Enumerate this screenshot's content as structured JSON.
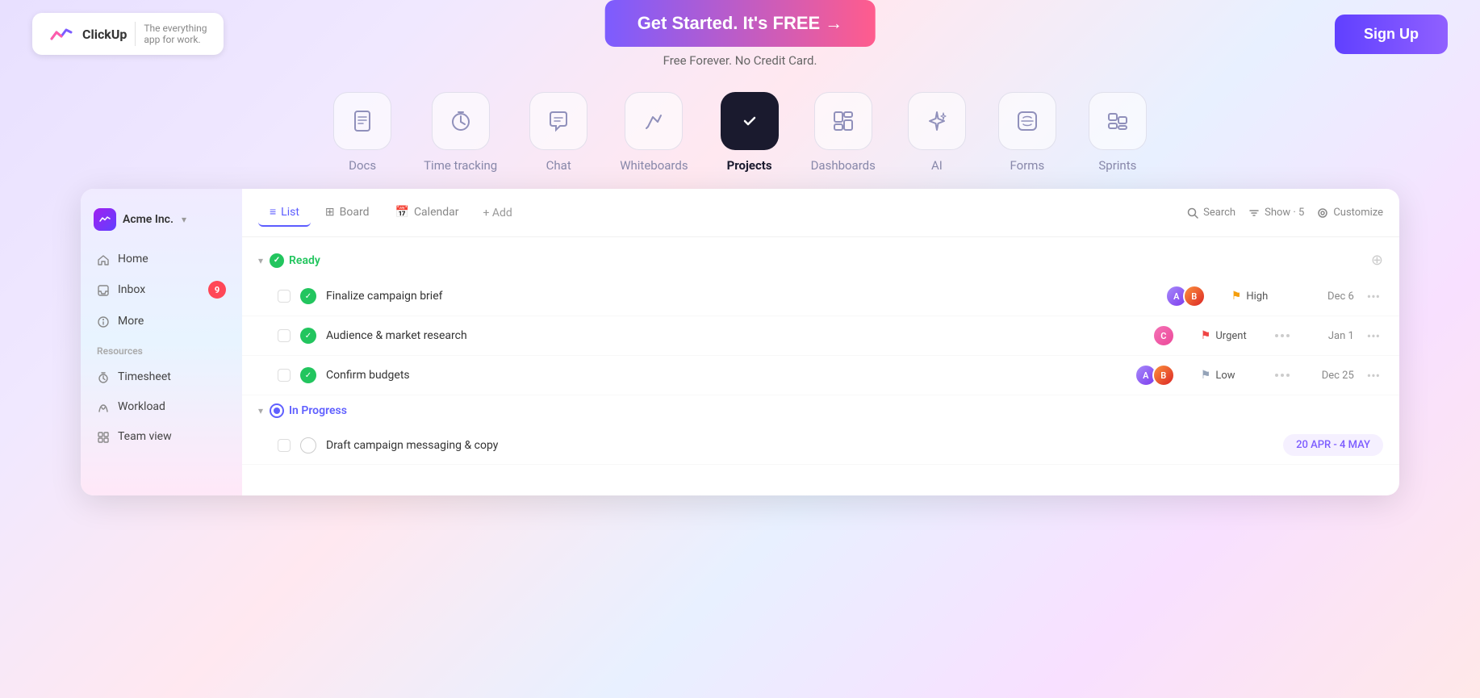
{
  "header": {
    "logo_name": "ClickUp",
    "logo_tagline": "The everything\napp for work.",
    "cta_button": "Get Started. It's FREE →",
    "cta_subtext": "Free Forever. No Credit Card.",
    "signup_button": "Sign Up"
  },
  "features": [
    {
      "id": "docs",
      "label": "Docs",
      "icon": "📄",
      "active": false
    },
    {
      "id": "time-tracking",
      "label": "Time tracking",
      "icon": "🕐",
      "active": false
    },
    {
      "id": "chat",
      "label": "Chat",
      "icon": "💬",
      "active": false
    },
    {
      "id": "whiteboards",
      "label": "Whiteboards",
      "icon": "✏️",
      "active": false
    },
    {
      "id": "projects",
      "label": "Projects",
      "icon": "✅",
      "active": true
    },
    {
      "id": "dashboards",
      "label": "Dashboards",
      "icon": "📊",
      "active": false
    },
    {
      "id": "ai",
      "label": "AI",
      "icon": "✨",
      "active": false
    },
    {
      "id": "forms",
      "label": "Forms",
      "icon": "📋",
      "active": false
    },
    {
      "id": "sprints",
      "label": "Sprints",
      "icon": "⚡",
      "active": false
    }
  ],
  "sidebar": {
    "workspace_name": "Acme Inc.",
    "nav_items": [
      {
        "label": "Home",
        "icon": "🏠",
        "badge": null
      },
      {
        "label": "Inbox",
        "icon": "📥",
        "badge": "9"
      },
      {
        "label": "More",
        "icon": "⊕",
        "badge": null
      }
    ],
    "resources_label": "Resources",
    "resource_items": [
      {
        "label": "Timesheet",
        "icon": "⏱"
      },
      {
        "label": "Workload",
        "icon": "🔄"
      },
      {
        "label": "Team view",
        "icon": "⊞"
      }
    ]
  },
  "toolbar": {
    "tabs": [
      {
        "label": "List",
        "icon": "≡",
        "active": true
      },
      {
        "label": "Board",
        "icon": "⊞",
        "active": false
      },
      {
        "label": "Calendar",
        "icon": "📅",
        "active": false
      }
    ],
    "add_label": "+ Add",
    "search_label": "Search",
    "show_label": "Show · 5",
    "customize_label": "Customize"
  },
  "sections": [
    {
      "id": "ready",
      "label": "Ready",
      "status": "ready",
      "tasks": [
        {
          "name": "Finalize campaign brief",
          "status": "done",
          "priority": "High",
          "priority_color": "#f59e0b",
          "date": "Dec 6",
          "avatars": [
            "A",
            "B"
          ]
        },
        {
          "name": "Audience & market research",
          "status": "done",
          "priority": "Urgent",
          "priority_color": "#ef4444",
          "date": "Jan 1",
          "avatars": [
            "C"
          ]
        },
        {
          "name": "Confirm budgets",
          "status": "done",
          "priority": "Low",
          "priority_color": "#94a3b8",
          "date": "Dec 25",
          "avatars": [
            "A",
            "B"
          ]
        }
      ]
    },
    {
      "id": "in-progress",
      "label": "In Progress",
      "status": "progress",
      "tasks": [
        {
          "name": "Draft campaign messaging & copy",
          "status": "empty",
          "priority": "",
          "date_range": "20 APR - 4 MAY",
          "avatars": []
        }
      ]
    }
  ]
}
